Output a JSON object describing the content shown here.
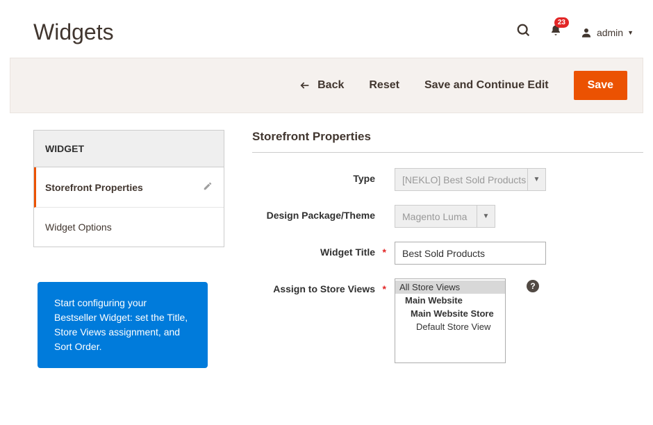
{
  "header": {
    "title": "Widgets",
    "notification_count": "23",
    "admin_label": "admin"
  },
  "actions": {
    "back": "Back",
    "reset": "Reset",
    "save_continue": "Save and Continue Edit",
    "save": "Save"
  },
  "sidebar": {
    "title": "WIDGET",
    "items": [
      {
        "label": "Storefront Properties",
        "active": true,
        "edit": true
      },
      {
        "label": "Widget Options",
        "active": false,
        "edit": false
      }
    ]
  },
  "callout": "Start configuring your Bestseller Widget: set the Title, Store Views assignment, and Sort Order.",
  "form": {
    "section_title": "Storefront Properties",
    "type_label": "Type",
    "type_value": "[NEKLO] Best Sold Products",
    "theme_label": "Design Package/Theme",
    "theme_value": "Magento Luma",
    "widget_title_label": "Widget Title",
    "widget_title_value": "Best Sold Products",
    "assign_label": "Assign to Store Views",
    "store_options": [
      {
        "label": "All Store Views",
        "bold": false,
        "indent": 0,
        "selected": true
      },
      {
        "label": "Main Website",
        "bold": true,
        "indent": 1,
        "selected": false
      },
      {
        "label": "Main Website Store",
        "bold": true,
        "indent": 2,
        "selected": false
      },
      {
        "label": "Default Store View",
        "bold": false,
        "indent": 3,
        "selected": false
      }
    ]
  }
}
